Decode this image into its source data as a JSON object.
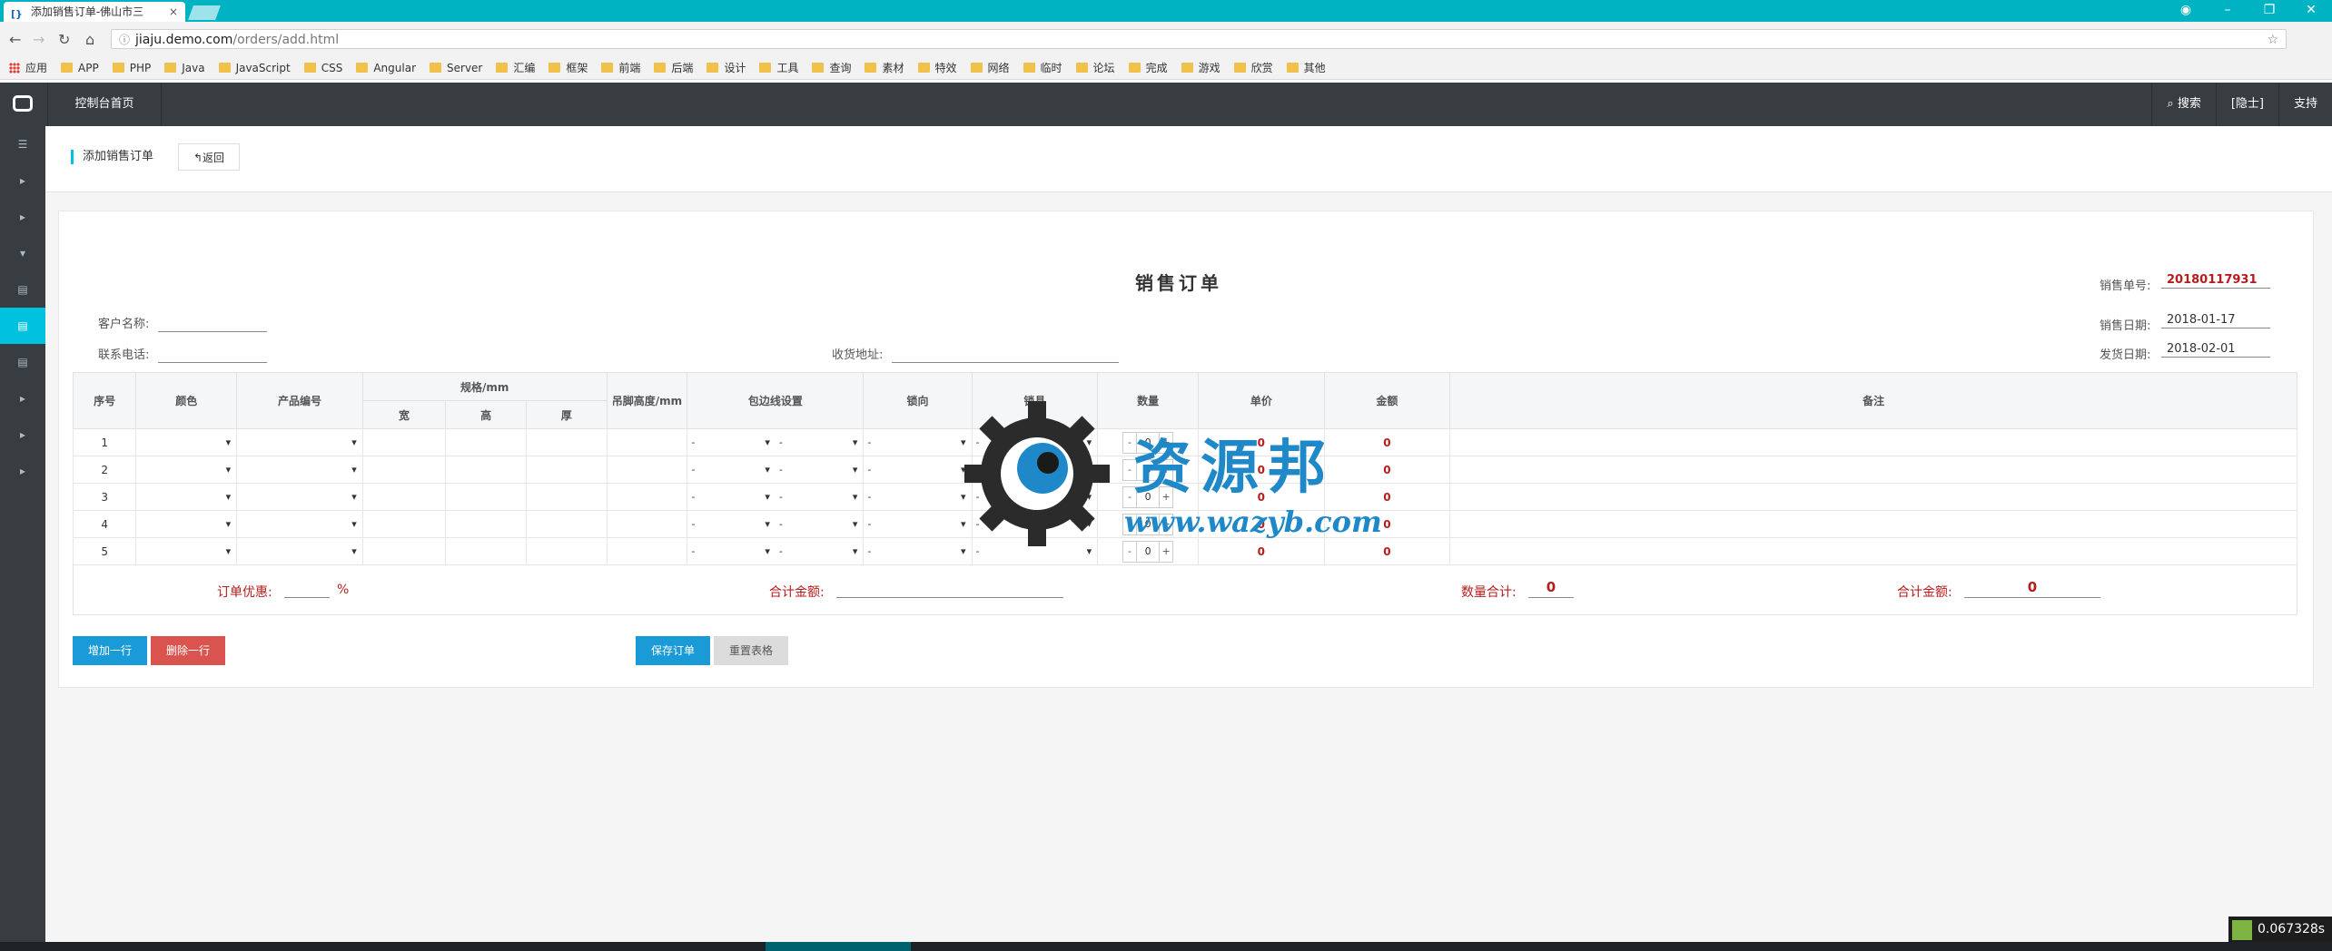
{
  "browser": {
    "tab_title": "添加销售订单-佛山市三",
    "url_host": "jiaju.demo.com",
    "url_path": "/orders/add.html",
    "bookmarks": [
      "应用",
      "APP",
      "PHP",
      "Java",
      "JavaScript",
      "CSS",
      "Angular",
      "Server",
      "汇编",
      "框架",
      "前端",
      "后端",
      "设计",
      "工具",
      "查询",
      "素材",
      "特效",
      "网络",
      "临时",
      "论坛",
      "完成",
      "游戏",
      "欣赏",
      "其他"
    ]
  },
  "header": {
    "home": "控制台首页",
    "search": "搜索",
    "user": "[隐士]",
    "support": "支持"
  },
  "page": {
    "title": "添加销售订单",
    "back": "返回"
  },
  "form": {
    "title": "销售订单",
    "customer_label": "客户名称:",
    "customer_value": "",
    "phone_label": "联系电话:",
    "phone_value": "",
    "address_label": "收货地址:",
    "address_value": "",
    "order_no_label": "销售单号:",
    "order_no": "20180117931",
    "sale_date_label": "销售日期:",
    "sale_date": "2018-01-17",
    "ship_date_label": "发货日期:",
    "ship_date": "2018-02-01"
  },
  "table": {
    "headers": {
      "seq": "序号",
      "color": "颜色",
      "product": "产品编号",
      "spec": "规格/mm",
      "width": "宽",
      "height": "高",
      "thick": "厚",
      "hang": "吊脚高度/mm",
      "edge": "包边线设置",
      "lock_dir": "锁向",
      "lock": "锁具",
      "qty": "数量",
      "price": "单价",
      "amount": "金额",
      "note": "备注"
    },
    "rows": [
      {
        "seq": "1",
        "qty": "0",
        "price": "0",
        "amount": "0"
      },
      {
        "seq": "2",
        "qty": "0",
        "price": "0",
        "amount": "0"
      },
      {
        "seq": "3",
        "qty": "0",
        "price": "0",
        "amount": "0"
      },
      {
        "seq": "4",
        "qty": "0",
        "price": "0",
        "amount": "0"
      },
      {
        "seq": "5",
        "qty": "0",
        "price": "0",
        "amount": "0"
      }
    ],
    "select_placeholder": "-"
  },
  "summary": {
    "discount_label": "订单优惠:",
    "discount_unit": "%",
    "total_label": "合计金额:",
    "qty_total_label": "数量合计:",
    "qty_total": "0",
    "amount_total_label": "合计金额:",
    "amount_total": "0"
  },
  "buttons": {
    "add_row": "增加一行",
    "del_row": "删除一行",
    "save": "保存订单",
    "reset": "重置表格"
  },
  "watermark": {
    "text": "资源邦",
    "url": "www.wazyb.com"
  },
  "timer": "0.067328s",
  "colors": {
    "accent": "#00c1de",
    "header_bg": "#373d41",
    "primary_btn": "#1a9bd7",
    "danger_btn": "#d9534f",
    "red_value": "#b71c1c"
  }
}
